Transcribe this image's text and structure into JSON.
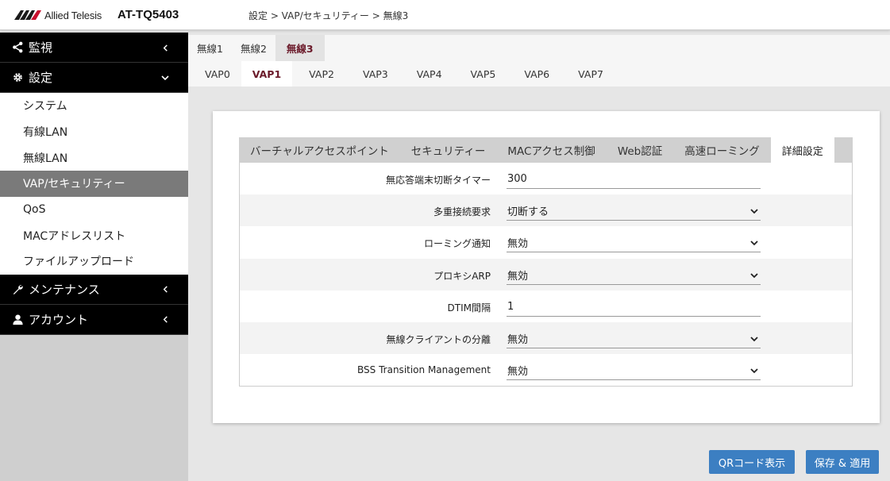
{
  "header": {
    "brand": "Allied Telesis",
    "model": "AT-TQ5403",
    "breadcrumb": "設定 > VAP/セキュリティー > 無線3"
  },
  "sidebar": {
    "sections": [
      {
        "label": "監視",
        "icon": "share-icon"
      },
      {
        "label": "設定",
        "icon": "gear-icon"
      },
      {
        "label": "メンテナンス",
        "icon": "wrench-icon"
      },
      {
        "label": "アカウント",
        "icon": "user-icon"
      }
    ],
    "settings_items": [
      "システム",
      "有線LAN",
      "無線LAN",
      "VAP/セキュリティー",
      "QoS",
      "MACアドレスリスト",
      "ファイルアップロード"
    ],
    "active_item": "VAP/セキュリティー"
  },
  "radio_tabs": [
    "無線1",
    "無線2",
    "無線3"
  ],
  "active_radio": "無線3",
  "vap_tabs": [
    "VAP0",
    "VAP1",
    "VAP2",
    "VAP3",
    "VAP4",
    "VAP5",
    "VAP6",
    "VAP7"
  ],
  "active_vap": "VAP1",
  "inner_tabs": [
    "バーチャルアクセスポイント",
    "セキュリティー",
    "MACアクセス制御",
    "Web認証",
    "高速ローミング",
    "詳細設定"
  ],
  "active_inner_tab": "詳細設定",
  "form": {
    "rows": [
      {
        "label": "無応答端末切断タイマー",
        "value": "300",
        "type": "input"
      },
      {
        "label": "多重接続要求",
        "value": "切断する",
        "type": "select"
      },
      {
        "label": "ローミング通知",
        "value": "無効",
        "type": "select"
      },
      {
        "label": "プロキシARP",
        "value": "無効",
        "type": "select"
      },
      {
        "label": "DTIM間隔",
        "value": "1",
        "type": "input"
      },
      {
        "label": "無線クライアントの分離",
        "value": "無効",
        "type": "select"
      },
      {
        "label": "BSS Transition Management",
        "value": "無効",
        "type": "select"
      }
    ]
  },
  "buttons": {
    "qr": "QRコード表示",
    "save": "保存 & 適用"
  },
  "colors": {
    "accent": "#3c7fc2",
    "active_tab_text": "#6b1a2a",
    "sidebar_active": "#7a7a7a"
  }
}
